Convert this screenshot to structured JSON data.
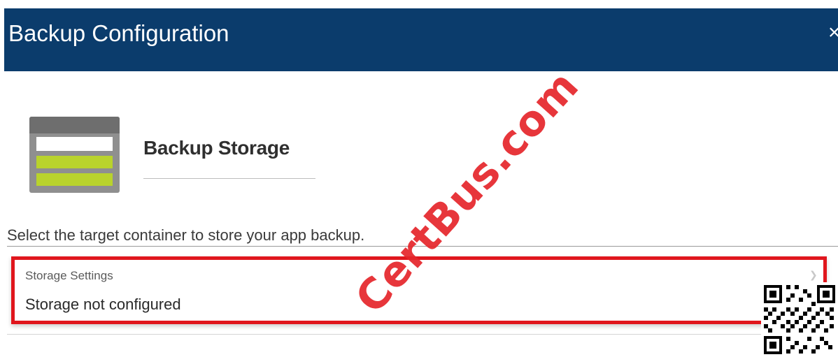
{
  "header": {
    "title": "Backup Configuration",
    "close_label": "×"
  },
  "section": {
    "title": "Backup Storage",
    "icon": "storage-container-icon"
  },
  "description": "Select the target container to store your app backup.",
  "storage_settings": {
    "label": "Storage Settings",
    "value": "Storage not configured"
  },
  "watermark": {
    "text": "CertBus.com"
  },
  "colors": {
    "header_bg": "#0b3c6c",
    "highlight_border": "#e0161d",
    "icon_green": "#b9d32c",
    "watermark": "#e5262b"
  }
}
